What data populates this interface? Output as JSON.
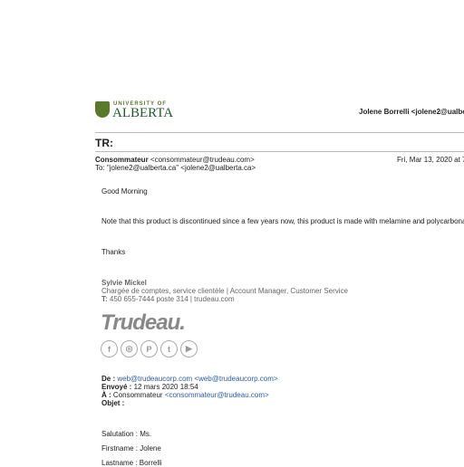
{
  "header": {
    "logo_top": "UNIVERSITY OF",
    "logo_main": "ALBERTA",
    "account": "Jolene Borrelli <jolene2@ualbe"
  },
  "subject": "TR:",
  "message": {
    "from_name": "Consommateur",
    "from_email": "<consommateur@trudeau.com>",
    "date": "Fri, Mar 13, 2020 at 7",
    "to": "To: \"jolene2@ualberta.ca\" <jolene2@ualberta.ca>"
  },
  "body": {
    "greeting": "Good Morning",
    "note": "Note that this product is discontinued since a few years now, this product is made with melamine and polycarbonate",
    "thanks": "Thanks"
  },
  "signature": {
    "name": "Sylvie Mickel",
    "title": "Chargée de comptes, service clientèle | Account Manager, Customer Service",
    "phone_label": "T:",
    "phone": " 450 655-7444 poste 314 | trudeau.com",
    "brand": "Trudeau.",
    "social": [
      "f",
      "◎",
      "P",
      "t",
      "▶"
    ]
  },
  "forwarded": {
    "de_label": "De :",
    "de_name": " web@trudeaucorp.com",
    "de_email": " <web@trudeaucorp.com>",
    "envoye_label": "Envoyé :",
    "envoye": " 12 mars 2020 18:54",
    "a_label": "À :",
    "a_name": " Consommateur ",
    "a_email": "<consommateur@trudeau.com>",
    "objet_label": "Objet :"
  },
  "fields": {
    "salutation": "Salutation : Ms.",
    "firstname": "Firstname : Jolene",
    "lastname": "Lastname : Borrelli"
  }
}
